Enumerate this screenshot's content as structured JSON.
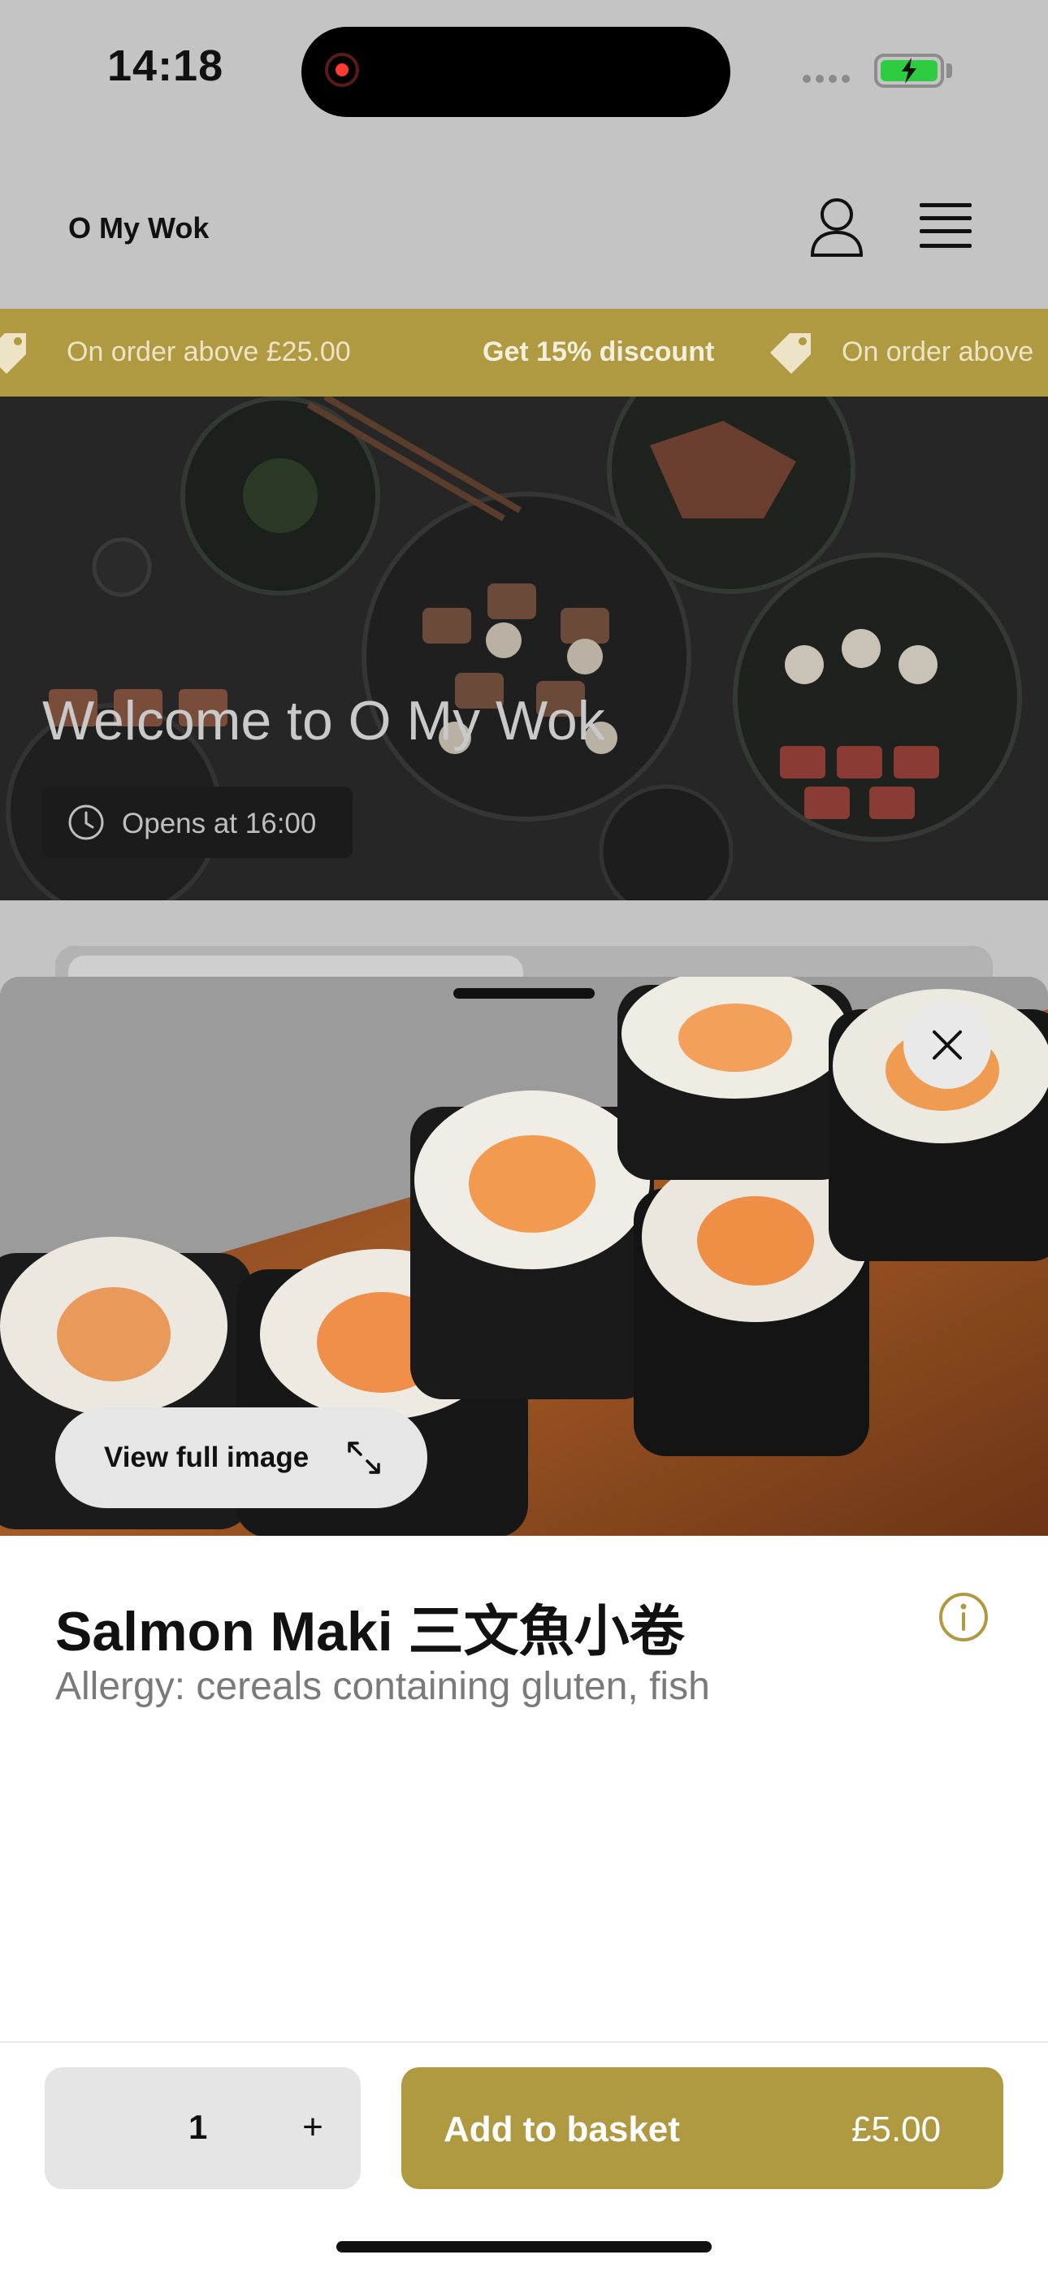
{
  "status_bar": {
    "time": "14:18"
  },
  "header": {
    "brand": "O My Wok"
  },
  "promo": {
    "text_1": "On order above £25.00",
    "bold_1": "Get 15% discount",
    "text_2": "On order above"
  },
  "hero": {
    "title": "Welcome to O My Wok",
    "opens": "Opens at 16:00"
  },
  "product": {
    "view_full_image": "View full image",
    "title": "Salmon Maki 三文魚小卷",
    "allergy": "Allergy: cereals containing gluten, fish"
  },
  "order": {
    "quantity": "1",
    "plus": "+",
    "add_label": "Add to basket",
    "price": "£5.00"
  },
  "colors": {
    "accent": "#b09a41",
    "overlay": "#c4c4c4"
  }
}
